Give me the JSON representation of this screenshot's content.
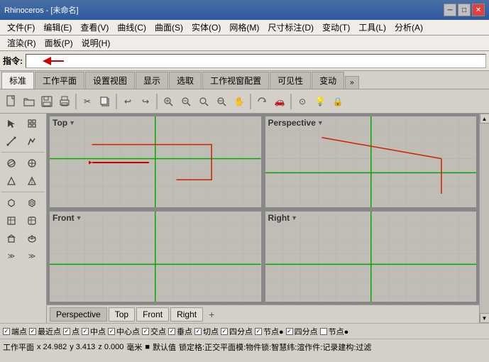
{
  "titlebar": {
    "text": "Rhinoceros - [未命名]",
    "minimize": "─",
    "maximize": "□",
    "close": "✕"
  },
  "menubar1": {
    "items": [
      "文件(F)",
      "编辑(E)",
      "查看(V)",
      "曲线(C)",
      "曲面(S)",
      "实体(O)",
      "网格(M)",
      "尺寸标注(D)",
      "变动(T)",
      "工具(L)",
      "分析(A)"
    ]
  },
  "menubar2": {
    "items": [
      "渲染(R)",
      "面板(P)",
      "说明(H)"
    ]
  },
  "command": {
    "label": "指令:",
    "placeholder": ""
  },
  "tabs": {
    "items": [
      "标准",
      "工作平面",
      "设置视图",
      "显示",
      "选取",
      "工作视窗配置",
      "可见性",
      "变动"
    ],
    "active": "标准",
    "more": "»"
  },
  "viewports": {
    "top": {
      "label": "Top",
      "dropdown": "▼"
    },
    "perspective": {
      "label": "Perspective",
      "dropdown": "▼"
    },
    "front": {
      "label": "Front",
      "dropdown": "▼"
    },
    "right": {
      "label": "Right",
      "dropdown": "▼"
    }
  },
  "bottom_tabs": {
    "items": [
      "Perspective",
      "Top",
      "Front",
      "Right"
    ],
    "active": "Perspective",
    "plus": "+"
  },
  "statusbar1": {
    "items": [
      {
        "label": "端点",
        "checked": true
      },
      {
        "label": "最近点",
        "checked": true
      },
      {
        "label": "点",
        "checked": true
      },
      {
        "label": "中点",
        "checked": true
      },
      {
        "label": "中心点",
        "checked": true
      },
      {
        "label": "交点",
        "checked": true
      },
      {
        "label": "垂点",
        "checked": true
      },
      {
        "label": "切点",
        "checked": true
      },
      {
        "label": "四分点",
        "checked": true
      },
      {
        "label": "节点●",
        "checked": true
      },
      {
        "label": "四分点",
        "checked": true
      },
      {
        "label": "节点●",
        "checked": false
      }
    ]
  },
  "statusbar2": {
    "workplane": "工作平面",
    "x": "x 24.982",
    "y": "y 3.413",
    "z": "z 0.000",
    "unit": "毫米",
    "square": "■",
    "default": "默认值",
    "status": "锁定格:正交平面模:物件锁:智慧纬:渲作件:记录建构:过滤"
  },
  "toolbar_icons": [
    "📂",
    "💾",
    "🖨",
    "✂",
    "📋",
    "↩",
    "↪",
    "🔍",
    "🔍",
    "🔍",
    "🔍",
    "🔍",
    "🔧",
    "🔧",
    "🔧",
    "🔧"
  ],
  "left_toolbar": {
    "rows": [
      [
        "↗",
        ""
      ],
      [
        "✎",
        "⬡"
      ],
      [
        "⟳",
        "⟳"
      ],
      [
        "▷",
        ""
      ],
      [
        "⬟",
        "⬟"
      ],
      [
        "≋",
        "≋"
      ],
      [
        "⬛",
        "⬛"
      ]
    ]
  }
}
